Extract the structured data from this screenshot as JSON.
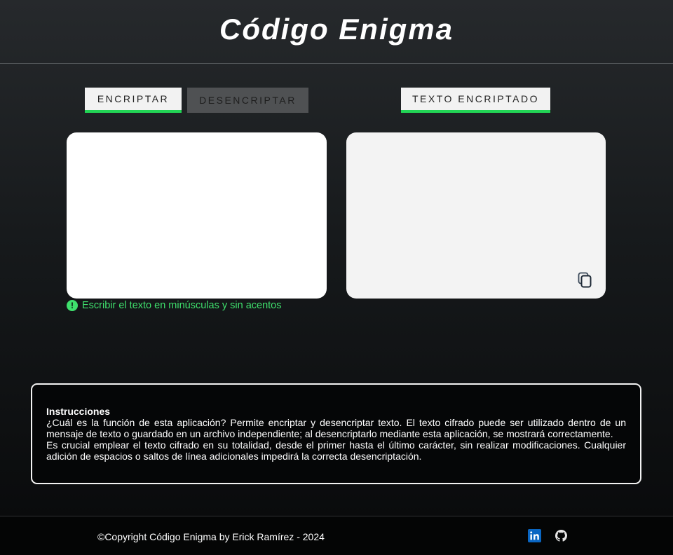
{
  "header": {
    "title": "Código Enigma"
  },
  "tabs": {
    "encrypt": "ENCRIPTAR",
    "decrypt": "DESENCRIPTAR",
    "output": "TEXTO ENCRIPTADO"
  },
  "input": {
    "value": "",
    "placeholder": ""
  },
  "hint": "Escribir el texto en minúsculas y sin acentos",
  "instructions": {
    "heading": "Instrucciones",
    "paragraph1": "¿Cuál es la función de esta aplicación? Permite encriptar y desencriptar texto. El texto cifrado puede ser utilizado dentro de un mensaje de texto o guardado en un archivo independiente; al desencriptarlo mediante esta aplicación, se mostrará correctamente.",
    "paragraph2": "Es crucial emplear el texto cifrado en su totalidad, desde el primer hasta el último carácter, sin realizar modificaciones. Cualquier adición de espacios o saltos de línea adicionales impedirá la correcta desencriptación."
  },
  "footer": {
    "copyright": "©Copyright Código Enigma by Erick Ramírez - 2024",
    "icons": [
      "linkedin-icon",
      "github-icon"
    ]
  },
  "colors": {
    "accent": "#22d455",
    "hint": "#3fe06d",
    "linkedin": "#0a66c2"
  }
}
